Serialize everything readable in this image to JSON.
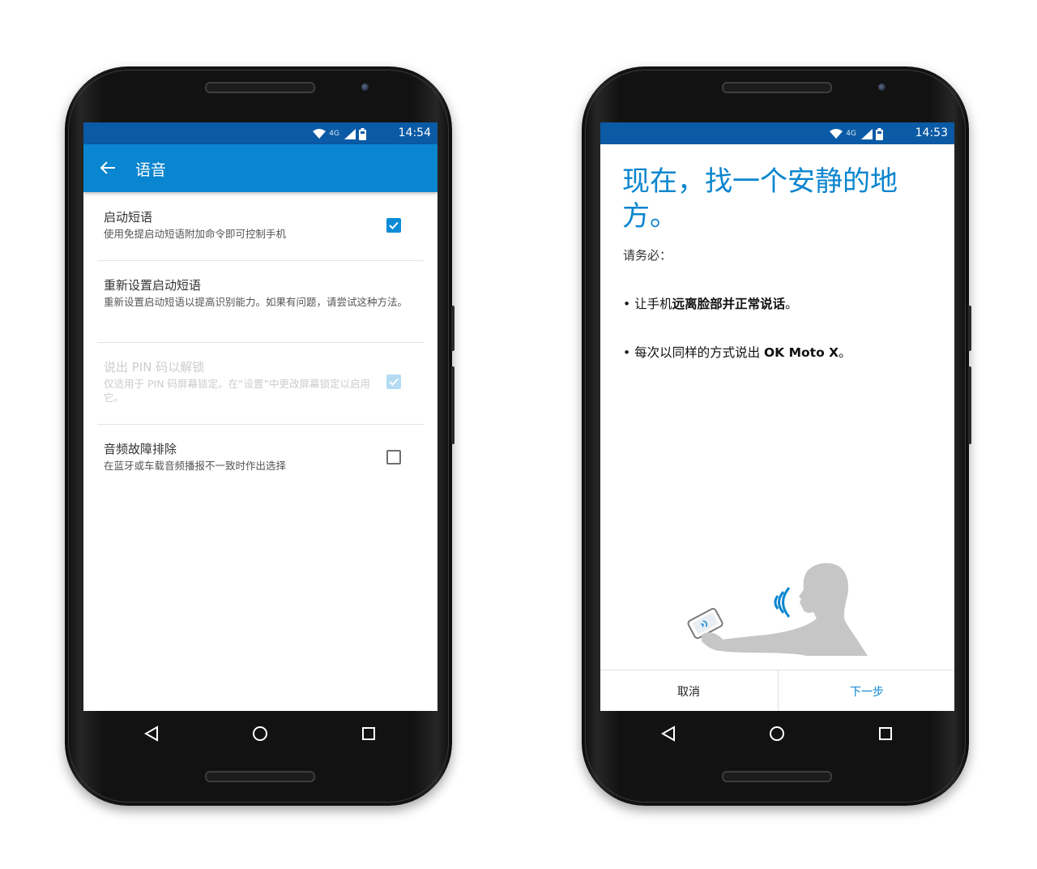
{
  "colors": {
    "primary": "#0a85cf",
    "statusbar": "#0b5aa5",
    "checkbox": "#0b8bd6"
  },
  "left_phone": {
    "status": {
      "network": "4G",
      "time": "14:54",
      "icons": [
        "wifi-icon",
        "signal-icon",
        "battery-icon"
      ]
    },
    "appbar": {
      "back_icon": "arrow-back-icon",
      "title": "语音"
    },
    "preferences": [
      {
        "title": "启动短语",
        "summary": "使用免提启动短语附加命令即可控制手机",
        "checkbox": "checked",
        "enabled": true
      },
      {
        "title": "重新设置启动短语",
        "summary": "重新设置启动短语以提高识别能力。如果有问题，请尝试这种方法。",
        "enabled": true
      },
      {
        "title": "说出 PIN 码以解锁",
        "summary": "仅适用于 PIN 码屏幕锁定。在“设置”中更改屏幕锁定以启用它。",
        "checkbox": "checked",
        "enabled": false
      },
      {
        "title": "音频故障排除",
        "summary": "在蓝牙或车载音频播报不一致时作出选择",
        "checkbox": "unchecked",
        "enabled": true
      }
    ],
    "navbar": [
      "back-icon",
      "home-icon",
      "recents-icon"
    ]
  },
  "right_phone": {
    "status": {
      "network": "4G",
      "time": "14:53",
      "icons": [
        "wifi-icon",
        "signal-icon",
        "battery-icon"
      ]
    },
    "headline": "现在，找一个安静的地方。",
    "intro": "请务必：",
    "bullet1": {
      "prefix": "• 让手机",
      "bold": "远离脸部",
      "middle": "并",
      "bold2": "正常说话",
      "suffix": "。"
    },
    "bullet2": {
      "prefix": "• 每次以同样的方式说出 ",
      "bold": "OK Moto X",
      "suffix": "。"
    },
    "illustration": "person-speaking-to-phone-illustration",
    "buttons": {
      "cancel": "取消",
      "next": "下一步"
    },
    "navbar": [
      "back-icon",
      "home-icon",
      "recents-icon"
    ]
  }
}
